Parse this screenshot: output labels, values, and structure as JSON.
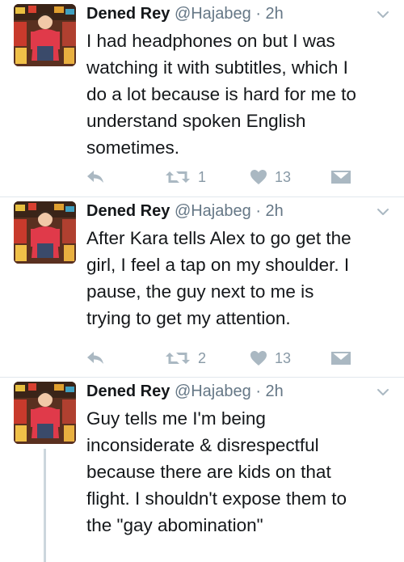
{
  "colors": {
    "icon_gray": "#aab8c2",
    "text_primary": "#14171a",
    "text_secondary": "#657786",
    "divider": "#e1e8ed"
  },
  "tweets": [
    {
      "author": {
        "name": "Dened Rey",
        "handle": "@Hajabeg",
        "separator": "·",
        "time": "2h"
      },
      "text_lines": [
        "I had headphones on but I was",
        "watching it with subtitles, which I",
        "do a lot because is hard for me to",
        "understand spoken English",
        "sometimes."
      ],
      "actions": {
        "reply_icon": "reply-icon",
        "retweet_icon": "retweet-icon",
        "retweet_count": "1",
        "like_icon": "heart-icon",
        "like_count": "13",
        "dm_icon": "envelope-icon"
      }
    },
    {
      "author": {
        "name": "Dened Rey",
        "handle": "@Hajabeg",
        "separator": "·",
        "time": "2h"
      },
      "text_lines": [
        "After Kara tells Alex to go get the",
        "girl, I feel a tap on my shoulder. I",
        "pause, the guy next to me is",
        "trying to get my attention."
      ],
      "actions": {
        "reply_icon": "reply-icon",
        "retweet_icon": "retweet-icon",
        "retweet_count": "2",
        "like_icon": "heart-icon",
        "like_count": "13",
        "dm_icon": "envelope-icon"
      }
    },
    {
      "author": {
        "name": "Dened Rey",
        "handle": "@Hajabeg",
        "separator": "·",
        "time": "2h"
      },
      "text_lines": [
        "Guy tells me I'm being",
        "inconsiderate & disrespectful",
        "because there are kids on that",
        "flight. I shouldn't expose them to",
        "the \"gay abomination\""
      ]
    }
  ]
}
